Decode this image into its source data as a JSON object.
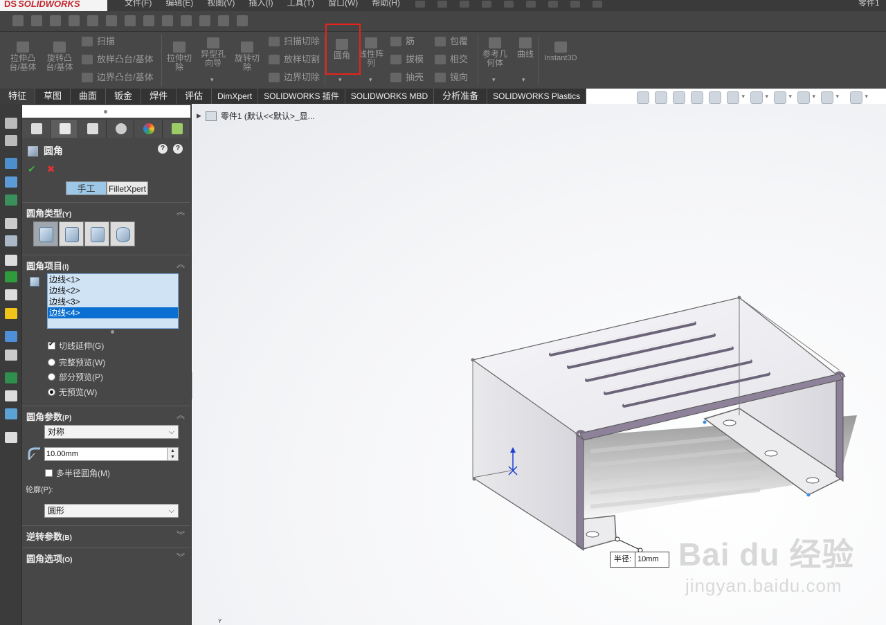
{
  "app": {
    "logo": "SOLIDWORKS",
    "logo_mark": "DS"
  },
  "menu": {
    "items": [
      "文件(F)",
      "编辑(E)",
      "视图(V)",
      "插入(I)",
      "工具(T)",
      "窗口(W)",
      "帮助(H)"
    ],
    "tail": "零件1"
  },
  "ribbon": {
    "extrude_boss": "拉伸凸台/基体",
    "revolve_boss": "旋转凸台/基体",
    "sweep": "扫描",
    "loft": "放样凸台/基体",
    "boundary_boss": "边界凸台/基体",
    "extrude_cut": "拉伸切除",
    "hole_wizard": "异型孔向导",
    "revolve_cut": "旋转切除",
    "swept_cut": "扫描切除",
    "lofted_cut": "放样切割",
    "boundary_cut": "边界切除",
    "fillet": "圆角",
    "linear_pattern": "线性阵列",
    "rib": "筋",
    "draft": "拔模",
    "shell": "抽壳",
    "wrap": "包覆",
    "intersect": "相交",
    "mirror": "镜向",
    "ref_geometry": "参考几何体",
    "curves": "曲线",
    "instant3d": "Instant3D"
  },
  "tabs": [
    "特征",
    "草图",
    "曲面",
    "钣金",
    "焊件",
    "评估",
    "DimXpert",
    "SOLIDWORKS 插件",
    "SOLIDWORKS MBD",
    "分析准备",
    "SOLIDWORKS Plastics"
  ],
  "panel": {
    "title": "圆角",
    "mode_manual": "手工",
    "mode_xpert": "FilletXpert",
    "help_1": "?",
    "help_2": "?",
    "ok": "✔",
    "cancel": "✖",
    "fillet_type": {
      "label": "圆角类型",
      "key": "(Y)"
    },
    "items": {
      "label": "圆角项目",
      "key": "(I)",
      "edges": [
        "边线<1>",
        "边线<2>",
        "边线<3>",
        "边线<4>"
      ],
      "selected_index": 3
    },
    "tangent_propagation": "切线延伸(G)",
    "full_preview": "完整预览(W)",
    "partial_preview": "部分预览(P)",
    "no_preview": "无预览(W)",
    "params": {
      "label": "圆角参数",
      "key": "(P)",
      "method": "对称",
      "radius": "10.00mm",
      "multi_radius": "多半径圆角(M)",
      "profile_label": "轮廓(P):",
      "profile": "圆形"
    },
    "setback": {
      "label": "逆转参数",
      "key": "(B)"
    },
    "options": {
      "label": "圆角选项",
      "key": "(O)"
    }
  },
  "viewport": {
    "tree_root": "零件1 (默认<<默认>_显...",
    "callout_label": "半径:",
    "callout_value": "10mm",
    "triad_y": "Y",
    "watermark_1": "Bai du 经验",
    "watermark_2": "jingyan.baidu.com"
  },
  "colors": {
    "highlight": "#e8231c",
    "accent": "#0a6fd0",
    "brand": "#c0272d"
  }
}
